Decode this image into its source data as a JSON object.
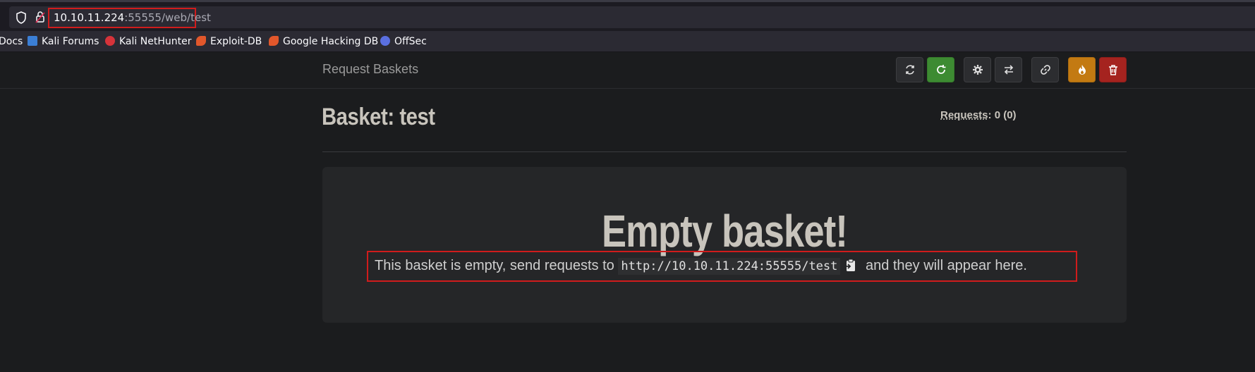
{
  "browser": {
    "url_host": "10.10.11.224",
    "url_path": ":55555/web/test",
    "bookmarks": [
      {
        "label": "Docs",
        "icon": "docs-icon"
      },
      {
        "label": "Kali Forums",
        "icon": "kali-forums-icon",
        "color": "#3b7fd6"
      },
      {
        "label": "Kali NetHunter",
        "icon": "kali-nethunter-icon",
        "color": "#d6333a"
      },
      {
        "label": "Exploit-DB",
        "icon": "exploit-db-icon",
        "color": "#e2572b"
      },
      {
        "label": "Google Hacking DB",
        "icon": "ghdb-icon",
        "color": "#e2572b"
      },
      {
        "label": "OffSec",
        "icon": "offsec-icon",
        "color": "#5a6fe0"
      }
    ]
  },
  "navbar": {
    "brand": "Request Baskets",
    "buttons": [
      {
        "name": "refresh-button",
        "icon": "refresh-icon",
        "style": "dark"
      },
      {
        "name": "auto-refresh-button",
        "icon": "auto-refresh-icon",
        "style": "green"
      },
      {
        "name": "settings-button",
        "icon": "gear-icon",
        "style": "dark"
      },
      {
        "name": "responses-button",
        "icon": "exchange-icon",
        "style": "dark"
      },
      {
        "name": "share-link-button",
        "icon": "link-icon",
        "style": "dark"
      },
      {
        "name": "delete-requests-button",
        "icon": "fire-icon",
        "style": "orange"
      },
      {
        "name": "delete-basket-button",
        "icon": "trash-icon",
        "style": "red"
      }
    ]
  },
  "basket": {
    "title": "Basket: test",
    "requests_label": "Requests",
    "requests_count": ": 0 (0)"
  },
  "empty": {
    "title": "Empty basket!",
    "msg_before": "This basket is empty, send requests to ",
    "msg_url": "http://10.10.11.224:55555/test",
    "msg_after": " and they will appear here."
  },
  "colors": {
    "accent_red": "#d01c1c",
    "green": "#3d8b32",
    "orange": "#c37a12",
    "red": "#a5231f"
  }
}
